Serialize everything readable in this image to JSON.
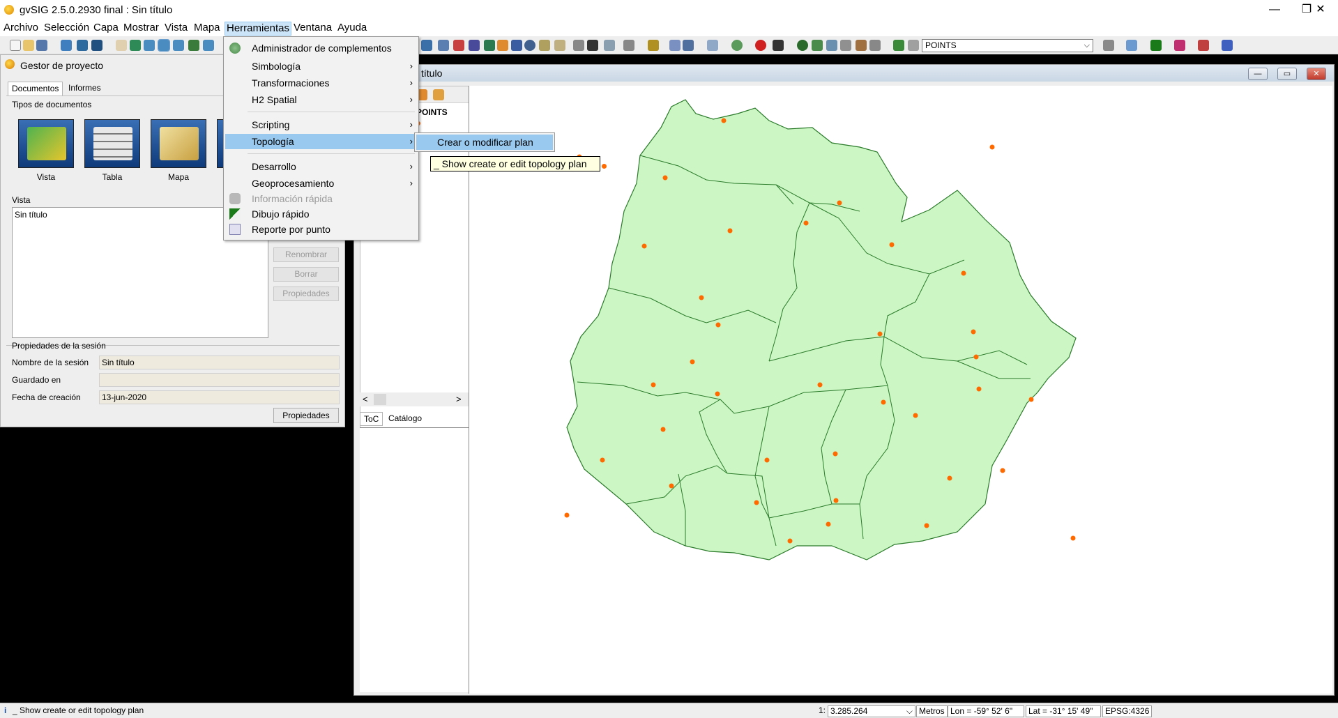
{
  "window": {
    "title": "gvSIG 2.5.0.2930 final : Sin título",
    "minimize": "—",
    "maximize": "❐",
    "close": "✕"
  },
  "menubar": [
    "Archivo",
    "Selección",
    "Capa",
    "Mostrar",
    "Vista",
    "Mapa",
    "Herramientas",
    "Ventana",
    "Ayuda"
  ],
  "toolbar": {
    "layer_select_value": "POINTS"
  },
  "project_manager": {
    "title": "Gestor de proyecto",
    "tabs": [
      "Documentos",
      "Informes"
    ],
    "doc_types_label": "Tipos de documentos",
    "doc_types": [
      "Vista",
      "Tabla",
      "Mapa"
    ],
    "list_label": "Vista",
    "list_items": [
      "Sin título"
    ],
    "buttons": [
      "Renombrar",
      "Borrar",
      "Propiedades"
    ],
    "session_label": "Propiedades de la sesión",
    "session_name_label": "Nombre de la sesión",
    "session_name_value": "Sin título",
    "saved_in_label": "Guardado en",
    "saved_in_value": "",
    "created_label": "Fecha de creación",
    "created_value": "13-jun-2020",
    "properties_button": "Propiedades"
  },
  "view": {
    "title": "título",
    "toc_layer": "POINTS",
    "toc_tabs": [
      "ToC",
      "Catálogo"
    ],
    "scroll_left": "<",
    "scroll_right": ">"
  },
  "dropdown": {
    "items": [
      {
        "label": "Administrador de complementos",
        "submenu": false,
        "disabled": false,
        "icon": "puzzle-icon"
      },
      {
        "label": "Simbología",
        "submenu": true,
        "disabled": false
      },
      {
        "label": "Transformaciones",
        "submenu": true,
        "disabled": false
      },
      {
        "label": "H2 Spatial",
        "submenu": true,
        "disabled": false
      },
      {
        "label": "Scripting",
        "submenu": true,
        "disabled": false
      },
      {
        "label": "Topología",
        "submenu": true,
        "disabled": false
      },
      {
        "label": "Desarrollo",
        "submenu": true,
        "disabled": false
      },
      {
        "label": "Geoprocesamiento",
        "submenu": true,
        "disabled": false
      },
      {
        "label": "Información rápida",
        "submenu": false,
        "disabled": true,
        "icon": "info-icon"
      },
      {
        "label": "Dibujo rápido",
        "submenu": false,
        "disabled": false,
        "icon": "pen-icon"
      },
      {
        "label": "Reporte por punto",
        "submenu": false,
        "disabled": false,
        "icon": "report-icon"
      }
    ],
    "chevron": "›",
    "submenu_item": "Crear o modificar plan",
    "tooltip": "_ Show create or edit topology plan"
  },
  "statusbar": {
    "message": "_ Show create or edit topology plan",
    "scale_prefix": "1:",
    "scale": "3.285.264",
    "units": "Metros",
    "lon": "Lon = -59° 52' 6\"",
    "lat": "Lat = -31° 15' 49\"",
    "epsg": "EPSG:4326"
  },
  "colors": {
    "polygon_fill": "#ccf7c4",
    "polygon_stroke": "#2a7a2a",
    "point": "#ff6a00",
    "highlight": "#99c9ef"
  }
}
